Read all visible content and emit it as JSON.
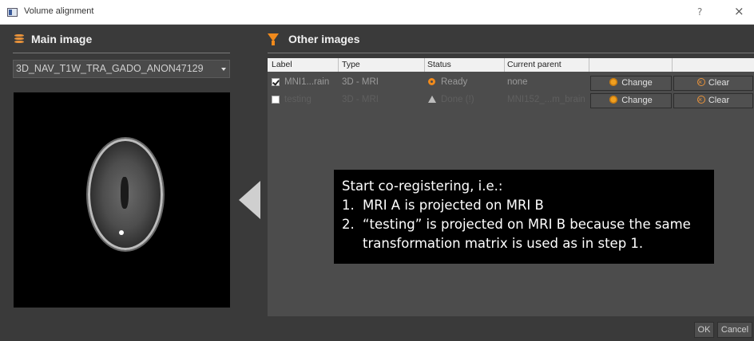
{
  "window": {
    "title": "Volume alignment",
    "help_label": "?",
    "close_label": "×"
  },
  "main": {
    "title": "Main image",
    "selected_image": "3D_NAV_T1W_TRA_GADO_ANON47129"
  },
  "other": {
    "title": "Other images",
    "columns": [
      "Label",
      "Type",
      "Status",
      "Current parent"
    ],
    "rows": [
      {
        "label": "MNI1...rain",
        "type": "3D - MRI",
        "status": "Ready",
        "parent": "none",
        "checked": true,
        "change": "Change",
        "clear": "Clear"
      },
      {
        "label": "testing",
        "type": "3D - MRI",
        "status": "Done (!)",
        "parent": "MNI152_...m_brain",
        "checked": false,
        "change": "Change",
        "clear": "Clear"
      }
    ]
  },
  "callout": {
    "heading": "Start co-registering, i.e.:",
    "items": [
      {
        "num": "1.",
        "text": "MRI A is projected on MRI B"
      },
      {
        "num": "2.",
        "text": "“testing” is projected on MRI B because the same transformation matrix is used as in step 1."
      }
    ]
  },
  "footer": {
    "ok": "OK",
    "cancel": "Cancel"
  },
  "colors": {
    "accent": "#f08a1c",
    "background": "#3a3a3a"
  },
  "icons": {
    "main_section": "database-icon",
    "other_section": "funnel-icon",
    "status_ready": "ring-icon",
    "status_done": "warning-triangle-icon",
    "change": "gear-icon",
    "clear": "x-circle-icon"
  }
}
